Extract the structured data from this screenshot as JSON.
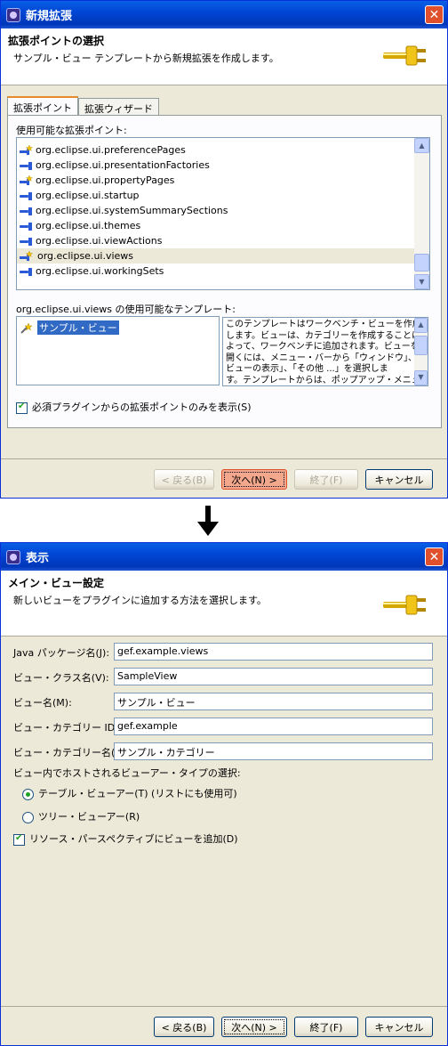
{
  "window1": {
    "title": "新規拡張",
    "header_title": "拡張ポイントの選択",
    "header_desc": "サンプル・ビュー テンプレートから新規拡張を作成します。",
    "tabs": [
      "拡張ポイント",
      "拡張ウィザード"
    ],
    "available_label": "使用可能な拡張ポイント:",
    "extension_points": [
      {
        "label": "org.eclipse.ui.preferencePages",
        "icon": "extension-template-icon"
      },
      {
        "label": "org.eclipse.ui.presentationFactories",
        "icon": "plug-icon"
      },
      {
        "label": "org.eclipse.ui.propertyPages",
        "icon": "extension-template-icon"
      },
      {
        "label": "org.eclipse.ui.startup",
        "icon": "plug-icon"
      },
      {
        "label": "org.eclipse.ui.systemSummarySections",
        "icon": "plug-icon"
      },
      {
        "label": "org.eclipse.ui.themes",
        "icon": "plug-icon"
      },
      {
        "label": "org.eclipse.ui.viewActions",
        "icon": "plug-icon"
      },
      {
        "label": "org.eclipse.ui.views",
        "icon": "extension-template-icon",
        "selected": true
      },
      {
        "label": "org.eclipse.ui.workingSets",
        "icon": "plug-icon"
      }
    ],
    "templates_label": "org.eclipse.ui.views の使用可能なテンプレート:",
    "templates": [
      "サンプル・ビュー"
    ],
    "template_desc_lines": [
      "このテンプレートはワークベンチ・ビューを作成",
      "します。ビューは、カテゴリーを作成することに",
      "よって、ワークベンチに追加されます。ビューを",
      "開くには、メニュー・バーから「ウィンドウ」、「",
      "ビューの表示」、「その他 ...」を選択しま",
      "す。テンプレートからは、ポップアップ・メニュー"
    ],
    "only_required_label": "必須プラグインからの拡張ポイントのみを表示(S)",
    "only_required_checked": true,
    "buttons": {
      "back": "< 戻る(B)",
      "next": "次へ(N) >",
      "finish": "終了(F)",
      "cancel": "キャンセル"
    }
  },
  "window2": {
    "title": "表示",
    "header_title": "メイン・ビュー設定",
    "header_desc": "新しいビューをプラグインに追加する方法を選択します。",
    "fields": [
      {
        "label": "Java パッケージ名(J):",
        "value": "gef.example.views"
      },
      {
        "label": "ビュー・クラス名(V):",
        "value": "SampleView"
      },
      {
        "label": "ビュー名(M):",
        "value": "サンプル・ビュー"
      },
      {
        "label": "ビュー・カテゴリー ID(C):",
        "value": "gef.example"
      },
      {
        "label": "ビュー・カテゴリー名(I):",
        "value": "サンプル・カテゴリー"
      }
    ],
    "viewer_type_label": "ビュー内でホストされるビューアー・タイプの選択:",
    "radio_table": "テーブル・ビューアー(T) (リストにも使用可)",
    "radio_tree": "ツリー・ビューアー(R)",
    "selected_viewer": "table",
    "add_perspective_label": "リソース・パースペクティブにビューを追加(D)",
    "add_perspective_checked": true,
    "buttons": {
      "back": "< 戻る(B)",
      "next": "次へ(N) >",
      "finish": "終了(F)",
      "cancel": "キャンセル"
    }
  }
}
